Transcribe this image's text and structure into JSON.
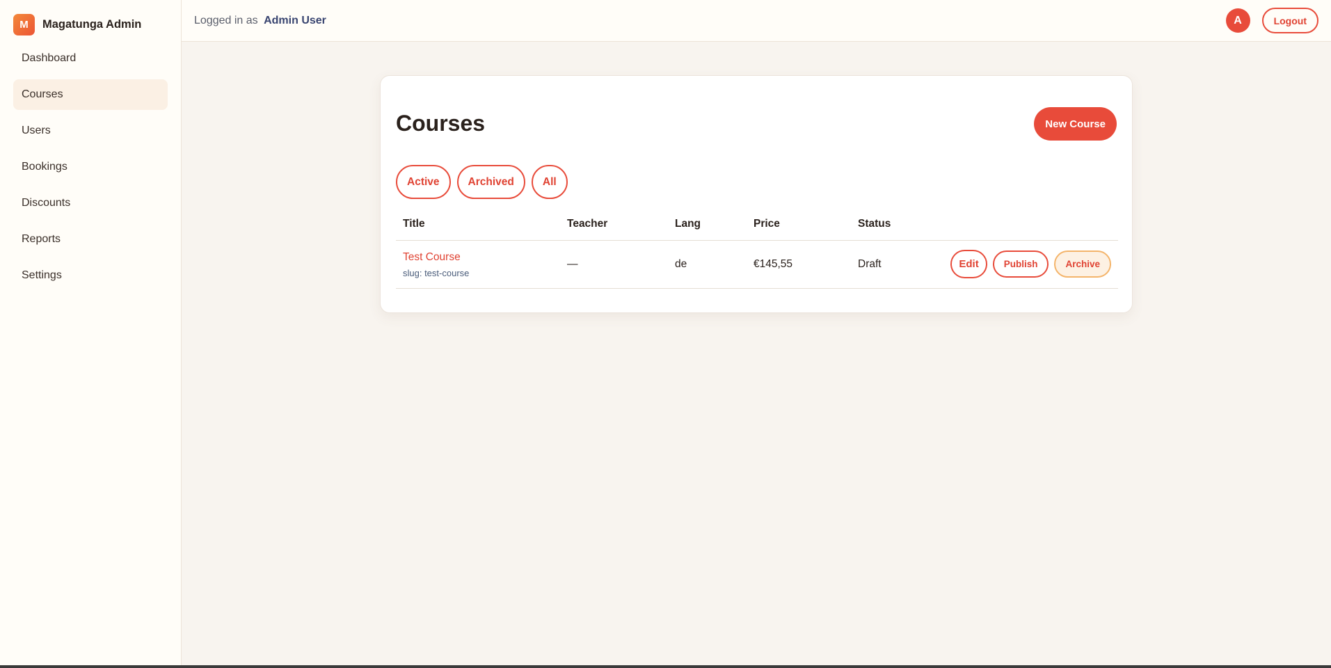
{
  "brand": {
    "logo_letter": "M",
    "name": "Magatunga Admin"
  },
  "sidebar": {
    "items": [
      {
        "label": "Dashboard",
        "active": false
      },
      {
        "label": "Courses",
        "active": true
      },
      {
        "label": "Users",
        "active": false
      },
      {
        "label": "Bookings",
        "active": false
      },
      {
        "label": "Discounts",
        "active": false
      },
      {
        "label": "Reports",
        "active": false
      },
      {
        "label": "Settings",
        "active": false
      }
    ]
  },
  "topbar": {
    "logged_in_prefix": "Logged in as",
    "user_name": "Admin User",
    "avatar_letter": "A",
    "logout_label": "Logout"
  },
  "page": {
    "title": "Courses",
    "new_button_label": "New Course",
    "filters": [
      "Active",
      "Archived",
      "All"
    ]
  },
  "table": {
    "headers": [
      "Title",
      "Teacher",
      "Lang",
      "Price",
      "Status",
      ""
    ],
    "rows": [
      {
        "title": "Test Course",
        "slug": "slug: test-course",
        "teacher": "—",
        "lang": "de",
        "price": "€145,55",
        "status": "Draft",
        "actions": [
          "Edit",
          "Publish",
          "Archive"
        ]
      }
    ]
  },
  "colors": {
    "accent": "#e84b3a",
    "background": "#f8f4ef",
    "sidebar_bg": "#fffdf8",
    "active_nav_bg": "#fbf0e4",
    "archive_border": "#f4b46a"
  }
}
